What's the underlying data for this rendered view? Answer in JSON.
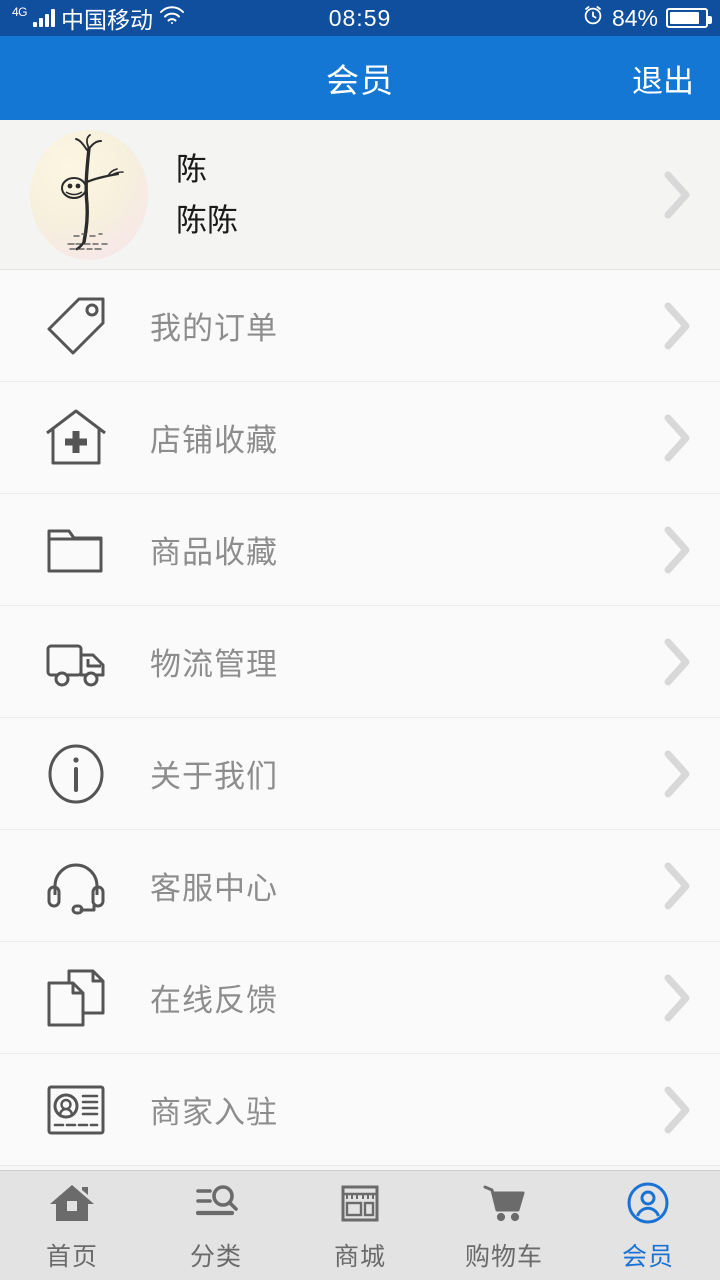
{
  "status_bar": {
    "network_type": "4G",
    "carrier": "中国移动",
    "wifi_icon": "wifi-icon",
    "time": "08:59",
    "alarm_icon": "alarm-clock-icon",
    "battery_percent": "84%",
    "battery_level": 84
  },
  "header": {
    "title": "会员",
    "action_label": "退出"
  },
  "profile": {
    "avatar_icon": "user-avatar",
    "name": "陈",
    "nickname": "陈陈",
    "chevron_icon": "chevron-right-icon"
  },
  "menu": {
    "items": [
      {
        "label": "我的订单",
        "icon": "tag-icon"
      },
      {
        "label": "店铺收藏",
        "icon": "house-plus-icon"
      },
      {
        "label": "商品收藏",
        "icon": "folder-icon"
      },
      {
        "label": "物流管理",
        "icon": "truck-icon"
      },
      {
        "label": "关于我们",
        "icon": "info-circle-icon"
      },
      {
        "label": "客服中心",
        "icon": "headset-icon"
      },
      {
        "label": "在线反馈",
        "icon": "documents-icon"
      },
      {
        "label": "商家入驻",
        "icon": "id-card-icon"
      }
    ],
    "chevron_icon": "chevron-right-icon"
  },
  "tabbar": {
    "items": [
      {
        "label": "首页",
        "icon": "home-icon",
        "active": false
      },
      {
        "label": "分类",
        "icon": "category-search-icon",
        "active": false
      },
      {
        "label": "商城",
        "icon": "store-icon",
        "active": false
      },
      {
        "label": "购物车",
        "icon": "cart-icon",
        "active": false
      },
      {
        "label": "会员",
        "icon": "member-icon",
        "active": true
      }
    ]
  },
  "colors": {
    "statusbar_blue": "#0f4f9e",
    "header_blue": "#1477d4",
    "accent_blue": "#1a73d4",
    "label_gray": "#8d8d8d",
    "icon_gray": "#555555",
    "chevron_gray": "#d8d8d8",
    "tabbar_bg": "#e3e3e3"
  }
}
